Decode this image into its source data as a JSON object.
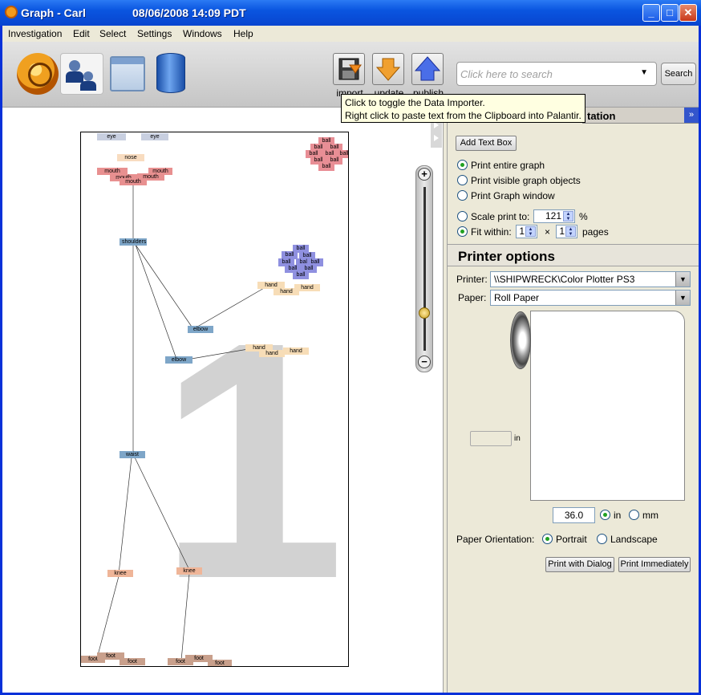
{
  "window": {
    "title": "Graph - Carl",
    "datetime": "08/06/2008 14:09 PDT",
    "controls": {
      "minimize": "_",
      "maximize": "□",
      "close": "✕"
    }
  },
  "menu": [
    "Investigation",
    "Edit",
    "Select",
    "Settings",
    "Windows",
    "Help"
  ],
  "toolbar": {
    "import_label": "import",
    "update_label": "update",
    "publish_label": "publish",
    "search_placeholder": "Click here to search",
    "search_button": "Search"
  },
  "tooltip": {
    "line1": "Click to toggle the Data Importer.",
    "line2": "Right click to paste text from the Clipboard into Palantir."
  },
  "graph": {
    "page_number": "1",
    "nodes": {
      "eye": "eye",
      "nose": "nose",
      "mouth": "mouth",
      "shoulders": "shoulders",
      "elbow": "elbow",
      "hand": "hand",
      "waist": "waist",
      "knee": "knee",
      "foot": "foot",
      "ball": "ball"
    }
  },
  "panel": {
    "tab_label": "tation",
    "add_text_box": "Add Text Box",
    "print_options": {
      "entire": "Print entire graph",
      "visible": "Print visible graph objects",
      "window": "Print Graph window",
      "selected": "entire"
    },
    "scale_label": "Scale print to:",
    "scale_value": "121",
    "scale_unit": "%",
    "fit_label": "Fit within:",
    "fit_x": "1",
    "fit_times": "×",
    "fit_y": "1",
    "fit_unit": "pages",
    "fit_selected": true,
    "printer_options_title": "Printer options",
    "printer_label": "Printer:",
    "printer_value": "\\\\SHIPWRECK\\Color Plotter PS3",
    "paper_label": "Paper:",
    "paper_value": "Roll Paper",
    "height_unit": "in",
    "width_value": "36.0",
    "unit_in": "in",
    "unit_mm": "mm",
    "unit_selected": "in",
    "orientation_label": "Paper Orientation:",
    "portrait": "Portrait",
    "landscape": "Landscape",
    "orientation_selected": "Portrait",
    "print_dialog": "Print with Dialog",
    "print_immediately": "Print Immediately"
  },
  "colors": {
    "titlebar": "#0a55e0",
    "highlight": "#21a121"
  }
}
